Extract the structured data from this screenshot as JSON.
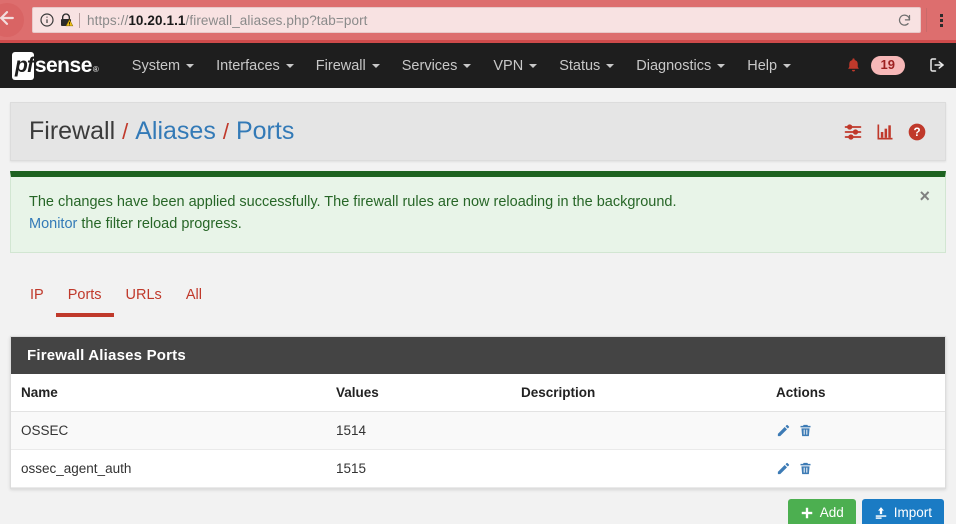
{
  "browser": {
    "back_icon": "back-arrow-icon",
    "info_icon": "info-icon",
    "security_icon": "lock-warning-icon",
    "url_scheme": "https://",
    "url_host": "10.20.1.1",
    "url_path": "/firewall_aliases.php?tab=port",
    "reload_icon": "reload-icon",
    "menu_icon": "hamburger-menu-icon"
  },
  "navbar": {
    "brand_pf": "pf",
    "brand_sense": "sense",
    "brand_reg": "®",
    "items": [
      {
        "label": "System"
      },
      {
        "label": "Interfaces"
      },
      {
        "label": "Firewall"
      },
      {
        "label": "Services"
      },
      {
        "label": "VPN"
      },
      {
        "label": "Status"
      },
      {
        "label": "Diagnostics"
      },
      {
        "label": "Help"
      }
    ],
    "notifications_icon": "bell-icon",
    "notifications_count": "19",
    "logout_icon": "logout-icon"
  },
  "breadcrumb": {
    "root": "Firewall",
    "sep": "/",
    "level2": "Aliases",
    "level3": "Ports",
    "icons": [
      {
        "name": "settings-sliders-icon"
      },
      {
        "name": "bar-chart-icon"
      },
      {
        "name": "help-circle-icon"
      }
    ]
  },
  "alert": {
    "line1": "The changes have been applied successfully. The firewall rules are now reloading in the background.",
    "link": "Monitor",
    "line2_rest": " the filter reload progress.",
    "close_label": "×",
    "border_color": "#1d6220",
    "background_color": "#e8f4e8",
    "text_color": "#276627"
  },
  "tabs": [
    {
      "label": "IP",
      "active": false
    },
    {
      "label": "Ports",
      "active": true
    },
    {
      "label": "URLs",
      "active": false
    },
    {
      "label": "All",
      "active": false
    }
  ],
  "panel": {
    "title": "Firewall Aliases Ports",
    "columns": [
      "Name",
      "Values",
      "Description",
      "Actions"
    ],
    "rows": [
      {
        "name": "OSSEC",
        "values": "1514",
        "description": "",
        "edit_icon": "edit-pencil-icon",
        "delete_icon": "trash-icon"
      },
      {
        "name": "ossec_agent_auth",
        "values": "1515",
        "description": "",
        "edit_icon": "edit-pencil-icon",
        "delete_icon": "trash-icon"
      }
    ]
  },
  "footer": {
    "add_label": "Add",
    "add_icon": "plus-icon",
    "add_color": "#4caf50",
    "import_label": "Import",
    "import_icon": "upload-icon",
    "import_color": "#1a7bc4"
  },
  "theme": {
    "accent_red": "#c0392b",
    "navbar_bg": "#1e1e1e",
    "page_bg": "#f2f2f2",
    "link_blue": "#337ab7",
    "chrome_bg": "#dd6e6e"
  }
}
